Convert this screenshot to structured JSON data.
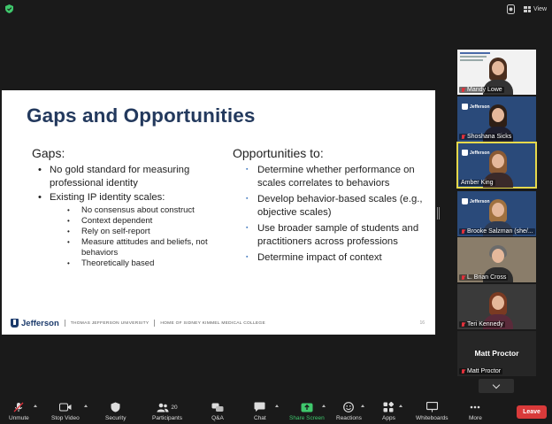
{
  "top_bar": {
    "view_label": "View"
  },
  "slide": {
    "title": "Gaps and Opportunities",
    "left": {
      "heading": "Gaps:",
      "items": [
        {
          "text": "No gold standard for measuring professional identity",
          "sub": []
        },
        {
          "text": "Existing IP identity scales:",
          "sub": [
            "No consensus about construct",
            "Context dependent",
            "Rely on self-report",
            "Measure attitudes and beliefs, not behaviors",
            "Theoretically based"
          ]
        }
      ]
    },
    "right": {
      "heading": "Opportunities to:",
      "items": [
        "Determine whether performance on scales correlates to behaviors",
        "Develop behavior-based scales (e.g., objective scales)",
        "Use broader sample of students and practitioners across professions",
        "Determine impact of context"
      ]
    },
    "footer": {
      "logo_text": "Jefferson",
      "university": "THOMAS JEFFERSON UNIVERSITY",
      "college": "HOME OF SIDNEY KIMMEL MEDICAL COLLEGE",
      "page_number": "16"
    }
  },
  "participants": [
    {
      "name": "Mandy Lowe",
      "muted": true
    },
    {
      "name": "Shoshana Sicks",
      "muted": true
    },
    {
      "name": "Amber King",
      "muted": false,
      "active_speaker": true
    },
    {
      "name": "Brooke Salzman (she/...",
      "muted": true
    },
    {
      "name": "L. Brian Cross",
      "muted": true
    },
    {
      "name": "Teri Kennedy",
      "muted": true
    },
    {
      "name": "Matt Proctor",
      "muted": true,
      "video_off": true
    }
  ],
  "toolbar": {
    "unmute": "Unmute",
    "stop_video": "Stop Video",
    "security": "Security",
    "participants": "Participants",
    "participants_count": "20",
    "qa": "Q&A",
    "chat": "Chat",
    "share_screen": "Share Screen",
    "reactions": "Reactions",
    "apps": "Apps",
    "whiteboards": "Whiteboards",
    "more": "More",
    "leave": "Leave"
  },
  "colors": {
    "share_green": "#3fc76c",
    "leave_red": "#d93a3a",
    "active_speaker": "#e6d94c",
    "slide_title": "#23395d"
  }
}
